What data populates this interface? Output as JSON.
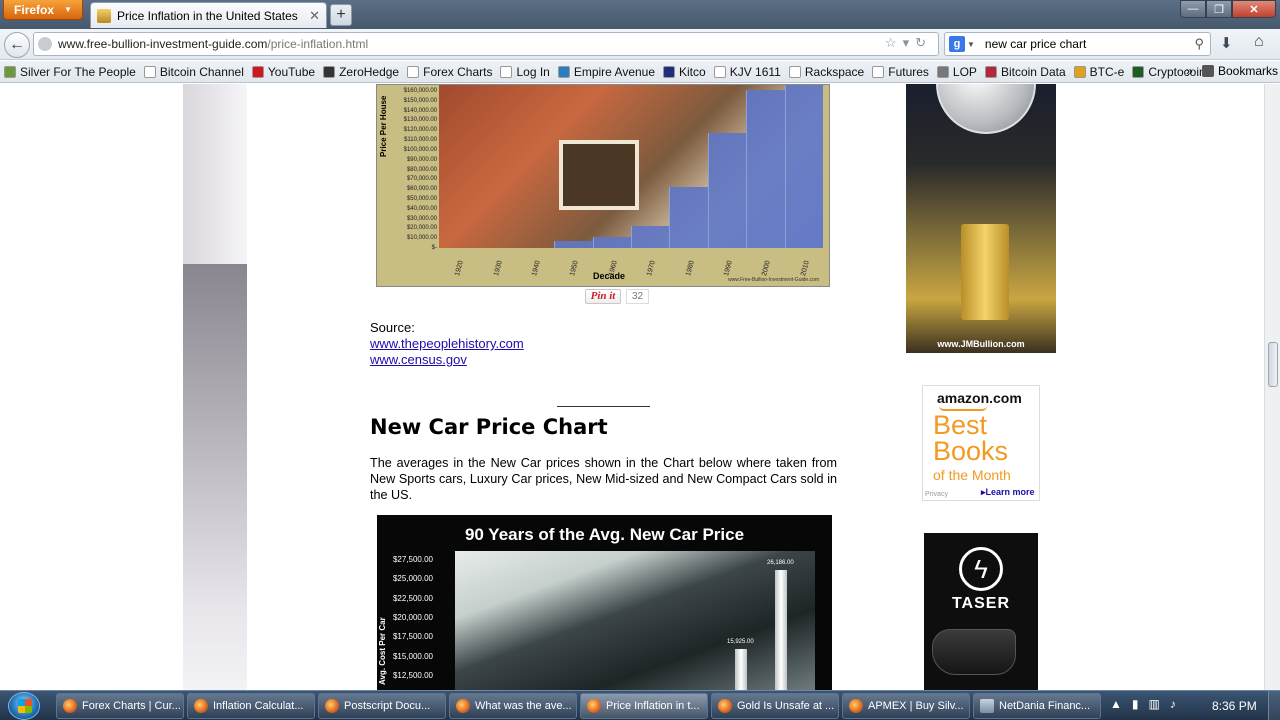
{
  "browser": {
    "app_button": "Firefox",
    "tab_title": "Price Inflation in the United States",
    "new_tab_label": "+",
    "url_host": "www.free-bullion-investment-guide.com",
    "url_path": "/price-inflation.html",
    "search_engine": "g",
    "search_query": "new car price chart",
    "win_min": "—",
    "win_max": "❐",
    "win_close": "✕"
  },
  "bookmarks": [
    {
      "label": "Silver For The People",
      "icon": "leaf-icon",
      "color": "#6a9a3a"
    },
    {
      "label": "Bitcoin Channel",
      "icon": "page-icon",
      "color": "#ffffff"
    },
    {
      "label": "YouTube",
      "icon": "youtube-icon",
      "color": "#cc181e"
    },
    {
      "label": "ZeroHedge",
      "icon": "zerohedge-icon",
      "color": "#333333"
    },
    {
      "label": "Forex Charts",
      "icon": "page-icon",
      "color": "#ffffff"
    },
    {
      "label": "Log In",
      "icon": "page-icon",
      "color": "#ffffff"
    },
    {
      "label": "Empire Avenue",
      "icon": "empire-icon",
      "color": "#2a7fbf"
    },
    {
      "label": "Kitco",
      "icon": "kitco-icon",
      "color": "#1e2e7a"
    },
    {
      "label": "KJV 1611",
      "icon": "cross-icon",
      "color": "#ffffff"
    },
    {
      "label": "Rackspace",
      "icon": "page-icon",
      "color": "#ffffff"
    },
    {
      "label": "Futures",
      "icon": "futures-icon",
      "color": "#ffffff"
    },
    {
      "label": "LOP",
      "icon": "globe-icon",
      "color": "#777777"
    },
    {
      "label": "Bitcoin Data",
      "icon": "bitcoin-data-icon",
      "color": "#b5273a"
    },
    {
      "label": "BTC-e",
      "icon": "coin-icon",
      "color": "#e0a21a"
    },
    {
      "label": "Cryptocoin",
      "icon": "cryptocoin-icon",
      "color": "#1b5e20"
    }
  ],
  "bookmarks_more": "»",
  "bookmarks_menu": "Bookmarks",
  "house_chart": {
    "type": "bar",
    "ylabel": "Price Per House",
    "xlabel": "Decade",
    "credit": "www.Free-Bullion-Investment-Guide.com",
    "yticks": [
      "$160,000.00",
      "$150,000.00",
      "$140,000.00",
      "$130,000.00",
      "$120,000.00",
      "$110,000.00",
      "$100,000.00",
      "$90,000.00",
      "$80,000.00",
      "$70,000.00",
      "$60,000.00",
      "$50,000.00",
      "$40,000.00",
      "$30,000.00",
      "$20,000.00",
      "$10,000.00",
      "$-"
    ],
    "categories": [
      "1920",
      "1930",
      "1940",
      "1950",
      "1960",
      "1970",
      "1980",
      "1990",
      "2000",
      "2010"
    ],
    "values": [
      0,
      0,
      0,
      7500,
      12000,
      23000,
      64000,
      120000,
      165000,
      170000
    ],
    "ylim": [
      0,
      170000
    ]
  },
  "pinit": {
    "label": "Pin it",
    "count": "32"
  },
  "source_label": "Source:",
  "source_links": [
    "www.thepeoplehistory.com",
    "www.census.gov"
  ],
  "section_title": "New Car Price Chart",
  "intro_text": "The averages in the New Car prices shown in the Chart below where taken from New Sports cars, Luxury Car prices, New Mid-sized and New Compact Cars sold in the US.",
  "chart_data": {
    "type": "bar",
    "title": "90 Years of the Avg. New Car  Price",
    "ylabel": "Avg. Cost Per Car",
    "yticks": [
      "$27,500.00",
      "$25,000.00",
      "$22,500.00",
      "$20,000.00",
      "$17,500.00",
      "$15,000.00",
      "$12,500.00"
    ],
    "ylim": [
      12500,
      27500
    ],
    "series": [
      {
        "values": [
          15925,
          26186
        ],
        "labels": [
          "15,925.00",
          "26,186.00"
        ]
      }
    ]
  },
  "ads": {
    "silver_url": "www.JMBullion.com",
    "amazon_logo": "amazon.com",
    "amazon_best": "Best Books",
    "amazon_month": "of the Month",
    "amazon_privacy": "Privacy",
    "amazon_learn": "▸Learn more",
    "taser_word": "TASER"
  },
  "taskbar": {
    "items": [
      "Forex Charts | Cur...",
      "Inflation Calculat...",
      "Postscript Docu...",
      "What was the ave...",
      "Price Inflation in t...",
      "Gold Is Unsafe at ...",
      "APMEX | Buy Silv...",
      "NetDania Financ..."
    ],
    "active_index": 4,
    "clock": "8:36 PM"
  }
}
